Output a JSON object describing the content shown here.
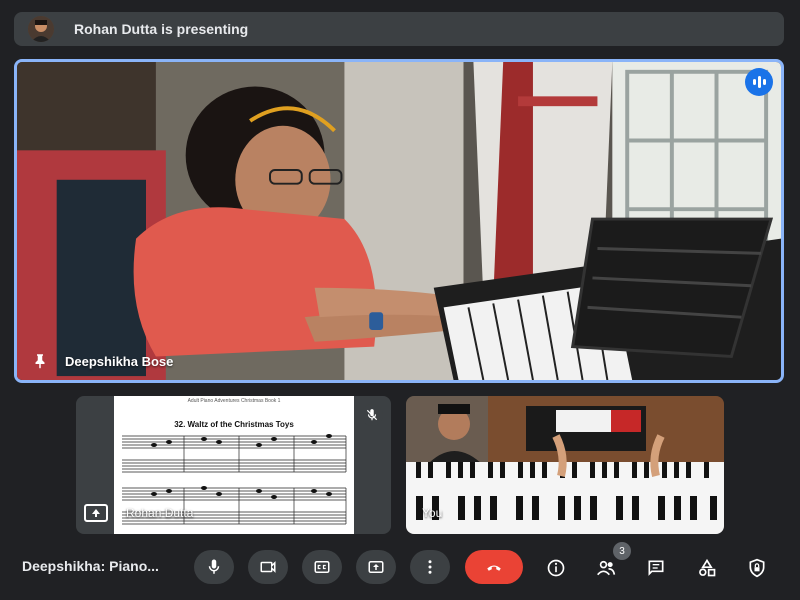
{
  "banner": {
    "text": "Rohan Dutta is presenting"
  },
  "main_tile": {
    "participant_name": "Deepshikha Bose",
    "pinned": true,
    "speaking": true
  },
  "tiles": [
    {
      "participant_name": "Rohan Dutta",
      "content": "presentation",
      "mic_muted": true,
      "sheet_header": "Adult Piano Adventures Christmas Book 1",
      "piece_title": "32. Waltz of the Christmas Toys"
    },
    {
      "participant_name": "You",
      "content": "camera"
    }
  ],
  "bottom_bar": {
    "meeting_title": "Deepshikha: Piano...",
    "participants_count": "3",
    "controls": [
      "microphone-icon",
      "camera-icon",
      "captions-icon",
      "present-screen-icon",
      "more-options-icon",
      "end-call-icon"
    ],
    "right_icons": [
      "info-icon",
      "people-icon",
      "chat-icon",
      "activities-icon",
      "host-controls-icon"
    ]
  },
  "colors": {
    "background": "#202124",
    "surface": "#3c4043",
    "active_border": "#8ab4f8",
    "speaking_blue": "#1a73e8",
    "end_call_red": "#ea4335"
  }
}
